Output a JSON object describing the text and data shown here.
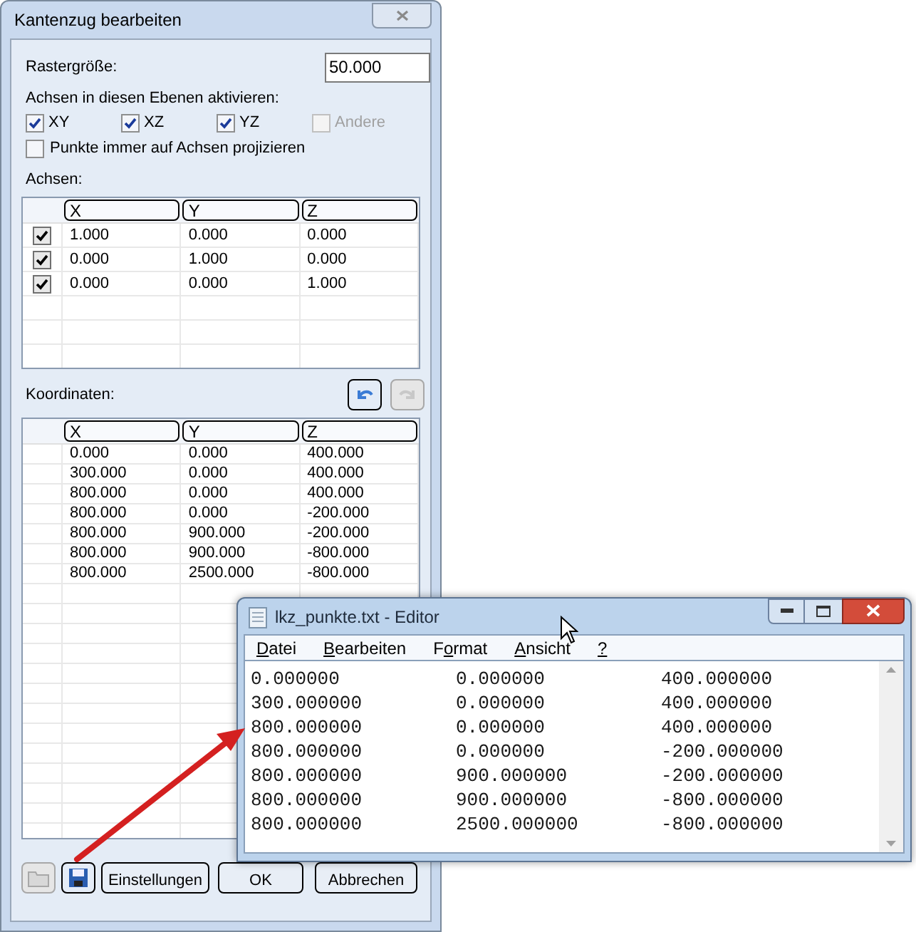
{
  "dialog": {
    "title": "Kantenzug bearbeiten",
    "grid_size": {
      "label": "Rastergröße:",
      "value": "50.000"
    },
    "planes_label": "Achsen in diesen Ebenen aktivieren:",
    "planes": [
      {
        "label": "XY",
        "checked": true,
        "disabled": false
      },
      {
        "label": "XZ",
        "checked": true,
        "disabled": false
      },
      {
        "label": "YZ",
        "checked": true,
        "disabled": false
      },
      {
        "label": "Andere",
        "checked": false,
        "disabled": true
      }
    ],
    "project_option": {
      "label": "Punkte immer auf Achsen projizieren",
      "checked": false
    },
    "axes": {
      "label": "Achsen:",
      "columns": [
        "X",
        "Y",
        "Z"
      ],
      "rows": [
        {
          "checked": true,
          "cells": [
            "1.000",
            "0.000",
            "0.000"
          ]
        },
        {
          "checked": true,
          "cells": [
            "0.000",
            "1.000",
            "0.000"
          ]
        },
        {
          "checked": true,
          "cells": [
            "0.000",
            "0.000",
            "1.000"
          ]
        }
      ]
    },
    "coordinates": {
      "label": "Koordinaten:",
      "tools": [
        {
          "kind": "undo",
          "disabled": false
        },
        {
          "kind": "redo",
          "disabled": true
        }
      ],
      "columns": [
        "X",
        "Y",
        "Z"
      ],
      "rows": [
        [
          "0.000",
          "0.000",
          "400.000"
        ],
        [
          "300.000",
          "0.000",
          "400.000"
        ],
        [
          "800.000",
          "0.000",
          "400.000"
        ],
        [
          "800.000",
          "0.000",
          "-200.000"
        ],
        [
          "800.000",
          "900.000",
          "-200.000"
        ],
        [
          "800.000",
          "900.000",
          "-800.000"
        ],
        [
          "800.000",
          "2500.000",
          "-800.000"
        ]
      ]
    },
    "footer_tools": [
      {
        "kind": "import",
        "disabled": true
      },
      {
        "kind": "save",
        "disabled": false
      }
    ],
    "buttons": [
      "Einstellungen",
      "OK",
      "Abbrechen"
    ]
  },
  "editor": {
    "title": "lkz_punkte.txt - Editor",
    "menu": [
      {
        "accel": "D",
        "rest": "atei"
      },
      {
        "accel": "B",
        "rest": "earbeiten"
      },
      {
        "lead": "F",
        "accel": "o",
        "rest": "rmat"
      },
      {
        "accel": "A",
        "rest": "nsicht"
      },
      {
        "accel": "?"
      }
    ],
    "lines": [
      [
        "0.000000",
        "0.000000",
        "400.000000"
      ],
      [
        "300.000000",
        "0.000000",
        "400.000000"
      ],
      [
        "800.000000",
        "0.000000",
        "400.000000"
      ],
      [
        "800.000000",
        "0.000000",
        "-200.000000"
      ],
      [
        "800.000000",
        "900.000000",
        "-200.000000"
      ],
      [
        "800.000000",
        "900.000000",
        "-800.000000"
      ],
      [
        "800.000000",
        "2500.000000",
        "-800.000000"
      ]
    ]
  }
}
